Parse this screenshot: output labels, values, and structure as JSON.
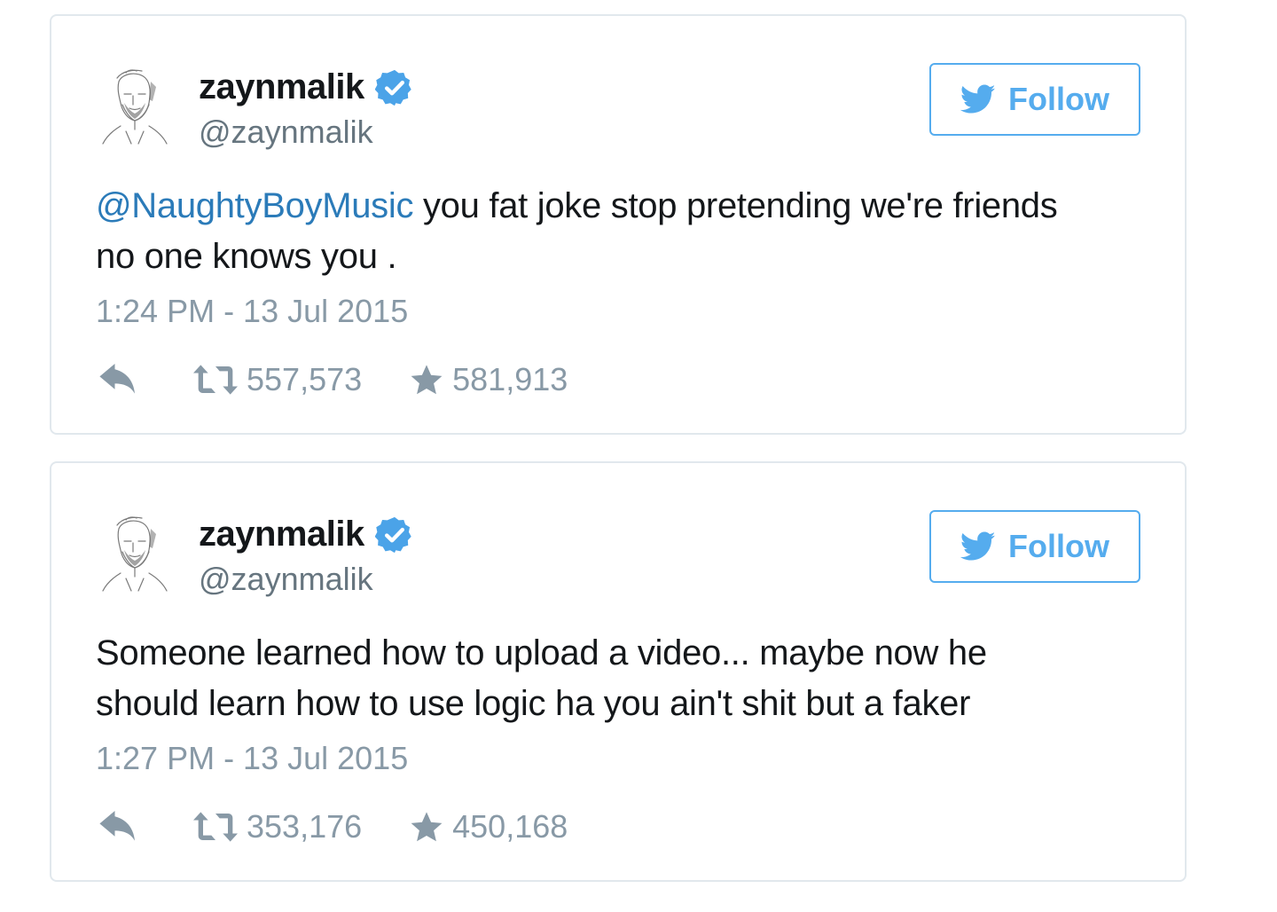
{
  "tweets": [
    {
      "display_name": "zaynmalik",
      "handle": "@zaynmalik",
      "follow_label": "Follow",
      "mention": "@NaughtyBoyMusic",
      "text_line1_rest": " you fat joke stop pretending we're friends",
      "text_line2": "no one knows you .",
      "timestamp": "1:24 PM - 13 Jul 2015",
      "retweets": "557,573",
      "favorites": "581,913"
    },
    {
      "display_name": "zaynmalik",
      "handle": "@zaynmalik",
      "follow_label": "Follow",
      "text_line1": "Someone learned how to upload a video... maybe now he",
      "text_line2": "should learn how to use logic ha you ain't shit but a faker",
      "timestamp": "1:27 PM - 13 Jul 2015",
      "retweets": "353,176",
      "favorites": "450,168"
    }
  ],
  "colors": {
    "accent": "#55acee",
    "link": "#2b7bb9",
    "muted": "#8899a6",
    "border": "#e1e8ed"
  },
  "icons": [
    "twitter-bird-icon",
    "verified-badge-icon",
    "reply-icon",
    "retweet-icon",
    "star-icon"
  ]
}
